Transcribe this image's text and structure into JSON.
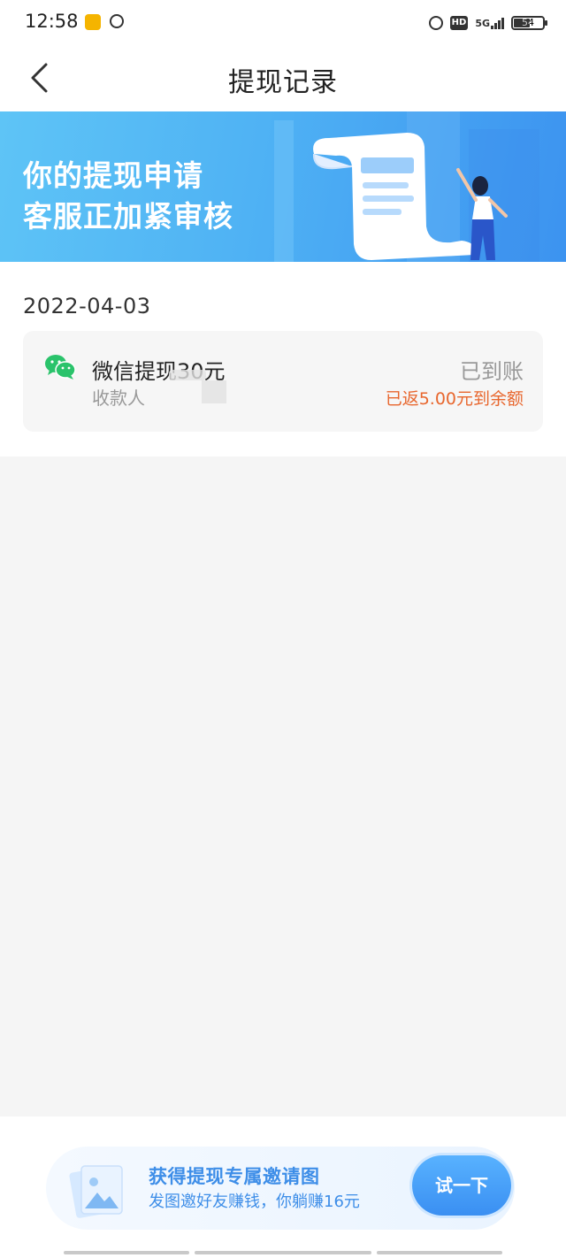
{
  "status_bar": {
    "time": "12:58",
    "hd": "HD",
    "network": "5G",
    "battery": "54"
  },
  "nav": {
    "title": "提现记录"
  },
  "banner": {
    "line1": "你的提现申请",
    "line2": "客服正加紧审核"
  },
  "records": [
    {
      "date": "2022-04-03",
      "title": "微信提现30元",
      "payee_label": "收款人",
      "status": "已到账",
      "note": "已返5.00元到余额",
      "icon": "wechat-icon"
    }
  ],
  "promo": {
    "title": "获得提现专属邀请图",
    "subtitle": "发图邀好友赚钱，你躺赚16元",
    "button": "试一下"
  },
  "colors": {
    "accent_blue": "#3e8ee8",
    "note_orange": "#e8662d",
    "wechat_green": "#2ac36b"
  }
}
